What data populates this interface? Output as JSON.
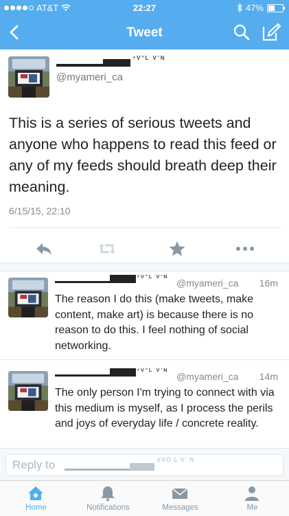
{
  "status": {
    "carrier": "AT&T",
    "time": "22:27",
    "battery": "47%"
  },
  "nav": {
    "title": "Tweet"
  },
  "tweet": {
    "handle": "@myameri_ca",
    "evolvin": "ᵉV°L V'N",
    "text": "This is a series of serious tweets and anyone who happens to read this feed or any of my feeds should breath deep their meaning.",
    "timestamp": "6/15/15, 22:10"
  },
  "replies": [
    {
      "evolvin": "ᵉV°L V'N",
      "handle": "@myameri_ca",
      "time": "16m",
      "text": "The reason I do this (make tweets, make content, make art) is because there is no reason to do this. I feel nothing of social networking."
    },
    {
      "evolvin": "ᵉV°L V'N",
      "handle": "@myameri_ca",
      "time": "14m",
      "text": "The only person I'm trying to connect with via this medium is myself, as I process the perils and joys of everyday life / concrete reality."
    }
  ],
  "reply_box": {
    "placeholder": "Reply to",
    "evolvin": "eVO L V' N"
  },
  "tabs": [
    {
      "label": "Home",
      "icon": "home-icon",
      "active": true
    },
    {
      "label": "Notifications",
      "icon": "bell-icon",
      "active": false
    },
    {
      "label": "Messages",
      "icon": "envelope-icon",
      "active": false
    },
    {
      "label": "Me",
      "icon": "person-icon",
      "active": false
    }
  ],
  "colors": {
    "accent": "#55acee",
    "inactive": "#8899a6"
  }
}
